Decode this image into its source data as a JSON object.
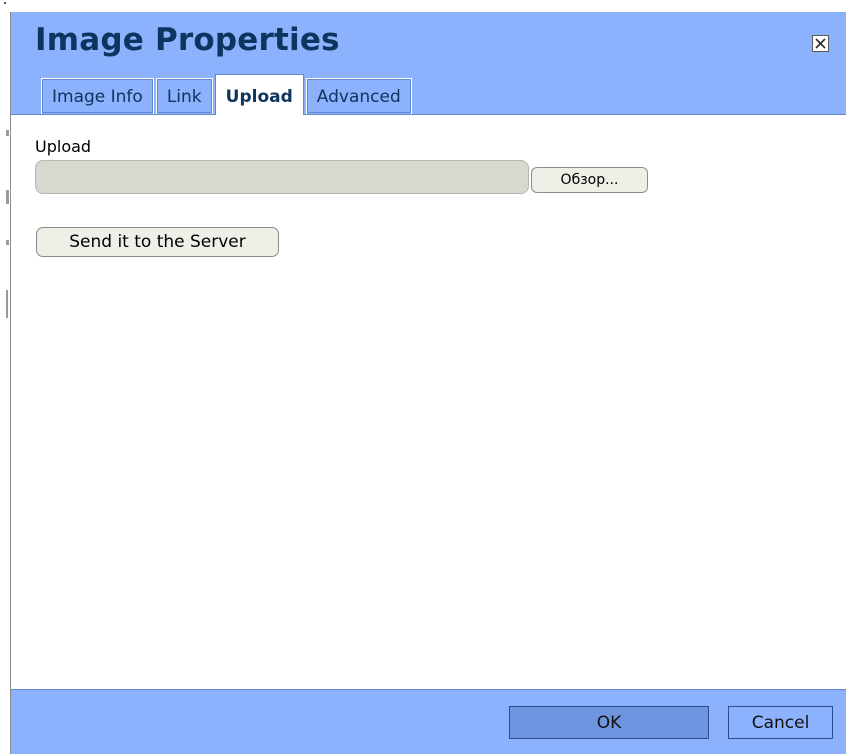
{
  "dialog": {
    "title": "Image Properties",
    "close_icon": "close-x-box-icon"
  },
  "tabs": [
    {
      "label": "Image Info",
      "active": false
    },
    {
      "label": "Link",
      "active": false
    },
    {
      "label": "Upload",
      "active": true
    },
    {
      "label": "Advanced",
      "active": false
    }
  ],
  "upload": {
    "label": "Upload",
    "file_value": "",
    "browse_label": "Обзор...",
    "send_label": "Send it to the Server"
  },
  "footer": {
    "ok_label": "OK",
    "cancel_label": "Cancel"
  },
  "colors": {
    "header_bg": "#8cb2fd",
    "title_text": "#0e3460",
    "ok_bg": "#6e96e0"
  }
}
